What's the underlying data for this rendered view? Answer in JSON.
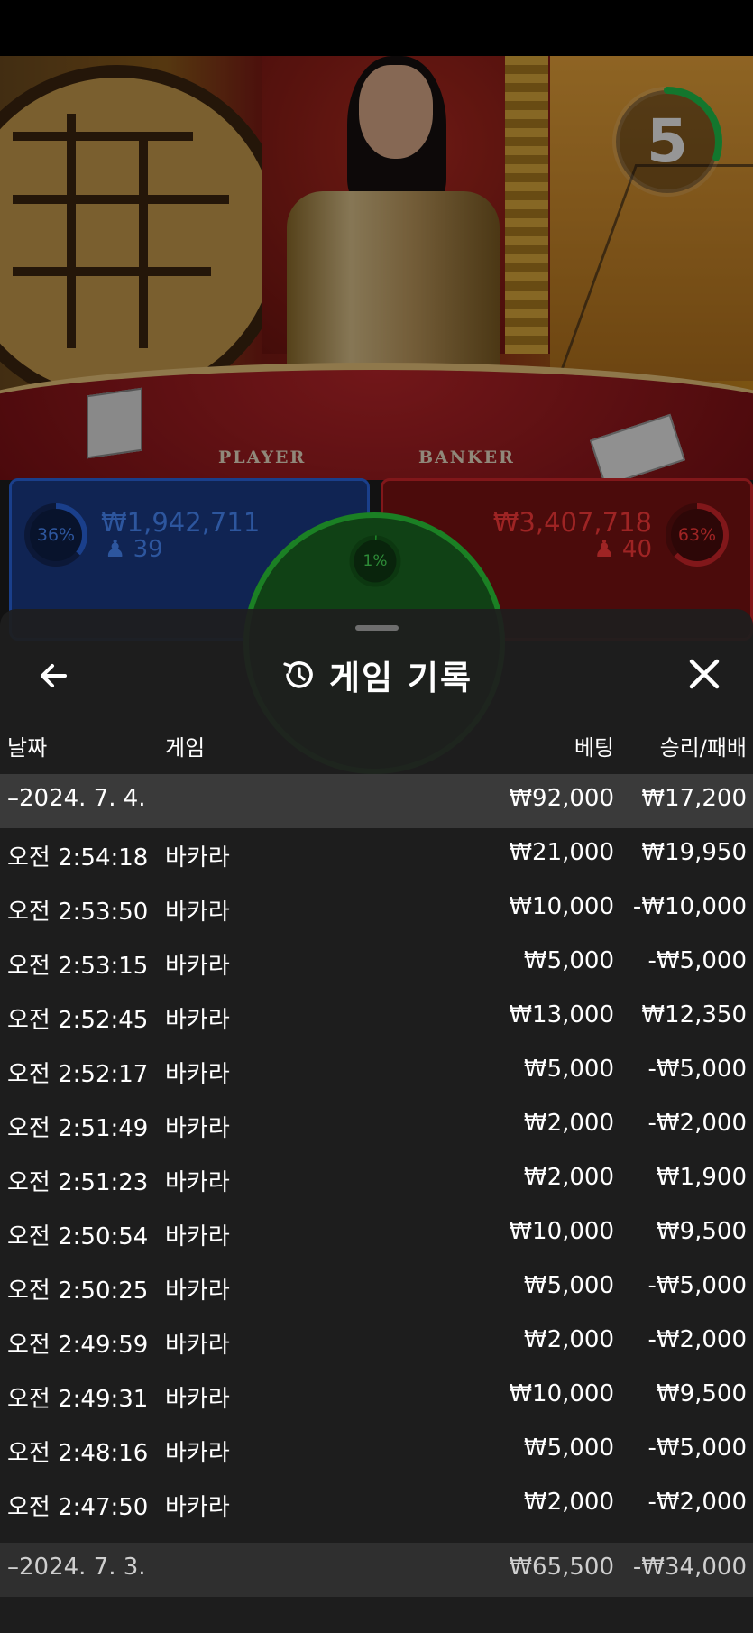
{
  "video": {
    "table_labels": {
      "player": "PLAYER",
      "banker": "BANKER"
    },
    "timer": {
      "value": "5",
      "progress": 0.3
    },
    "player_bets": {
      "percent": "36%",
      "percent_value": 0.36,
      "amount": "₩1,942,711",
      "players": "39"
    },
    "banker_bets": {
      "percent": "63%",
      "percent_value": 0.63,
      "amount": "₩3,407,718",
      "players": "40"
    },
    "tie_bets": {
      "percent": "1%",
      "percent_value": 0.01
    }
  },
  "history": {
    "title": "게임 기록",
    "back_icon": "arrow-left-icon",
    "title_icon": "history-icon",
    "close_icon": "close-icon",
    "columns": {
      "date": "날짜",
      "game": "게임",
      "bet": "베팅",
      "result": "승리/패배"
    },
    "date_group": {
      "label": "–2024. 7. 4.",
      "bet": "₩92,000",
      "result": "₩17,200"
    },
    "rows": [
      {
        "time": "오전 2:54:18",
        "game": "바카라",
        "bet": "₩21,000",
        "result": "₩19,950"
      },
      {
        "time": "오전 2:53:50",
        "game": "바카라",
        "bet": "₩10,000",
        "result": "-₩10,000"
      },
      {
        "time": "오전 2:53:15",
        "game": "바카라",
        "bet": "₩5,000",
        "result": "-₩5,000"
      },
      {
        "time": "오전 2:52:45",
        "game": "바카라",
        "bet": "₩13,000",
        "result": "₩12,350"
      },
      {
        "time": "오전 2:52:17",
        "game": "바카라",
        "bet": "₩5,000",
        "result": "-₩5,000"
      },
      {
        "time": "오전 2:51:49",
        "game": "바카라",
        "bet": "₩2,000",
        "result": "-₩2,000"
      },
      {
        "time": "오전 2:51:23",
        "game": "바카라",
        "bet": "₩2,000",
        "result": "₩1,900"
      },
      {
        "time": "오전 2:50:54",
        "game": "바카라",
        "bet": "₩10,000",
        "result": "₩9,500"
      },
      {
        "time": "오전 2:50:25",
        "game": "바카라",
        "bet": "₩5,000",
        "result": "-₩5,000"
      },
      {
        "time": "오전 2:49:59",
        "game": "바카라",
        "bet": "₩2,000",
        "result": "-₩2,000"
      },
      {
        "time": "오전 2:49:31",
        "game": "바카라",
        "bet": "₩10,000",
        "result": "₩9,500"
      },
      {
        "time": "오전 2:48:16",
        "game": "바카라",
        "bet": "₩5,000",
        "result": "-₩5,000"
      },
      {
        "time": "오전 2:47:50",
        "game": "바카라",
        "bet": "₩2,000",
        "result": "-₩2,000"
      }
    ],
    "date_group_2": {
      "label": "–2024. 7. 3.",
      "bet": "₩65,500",
      "result": "-₩34,000"
    }
  },
  "colors": {
    "player_blue": "#2a66e0",
    "banker_red": "#d0262a",
    "tie_green": "#2ccf3a",
    "timer_green": "#1fbf4a",
    "sheet_bg": "#1e1e1e"
  }
}
